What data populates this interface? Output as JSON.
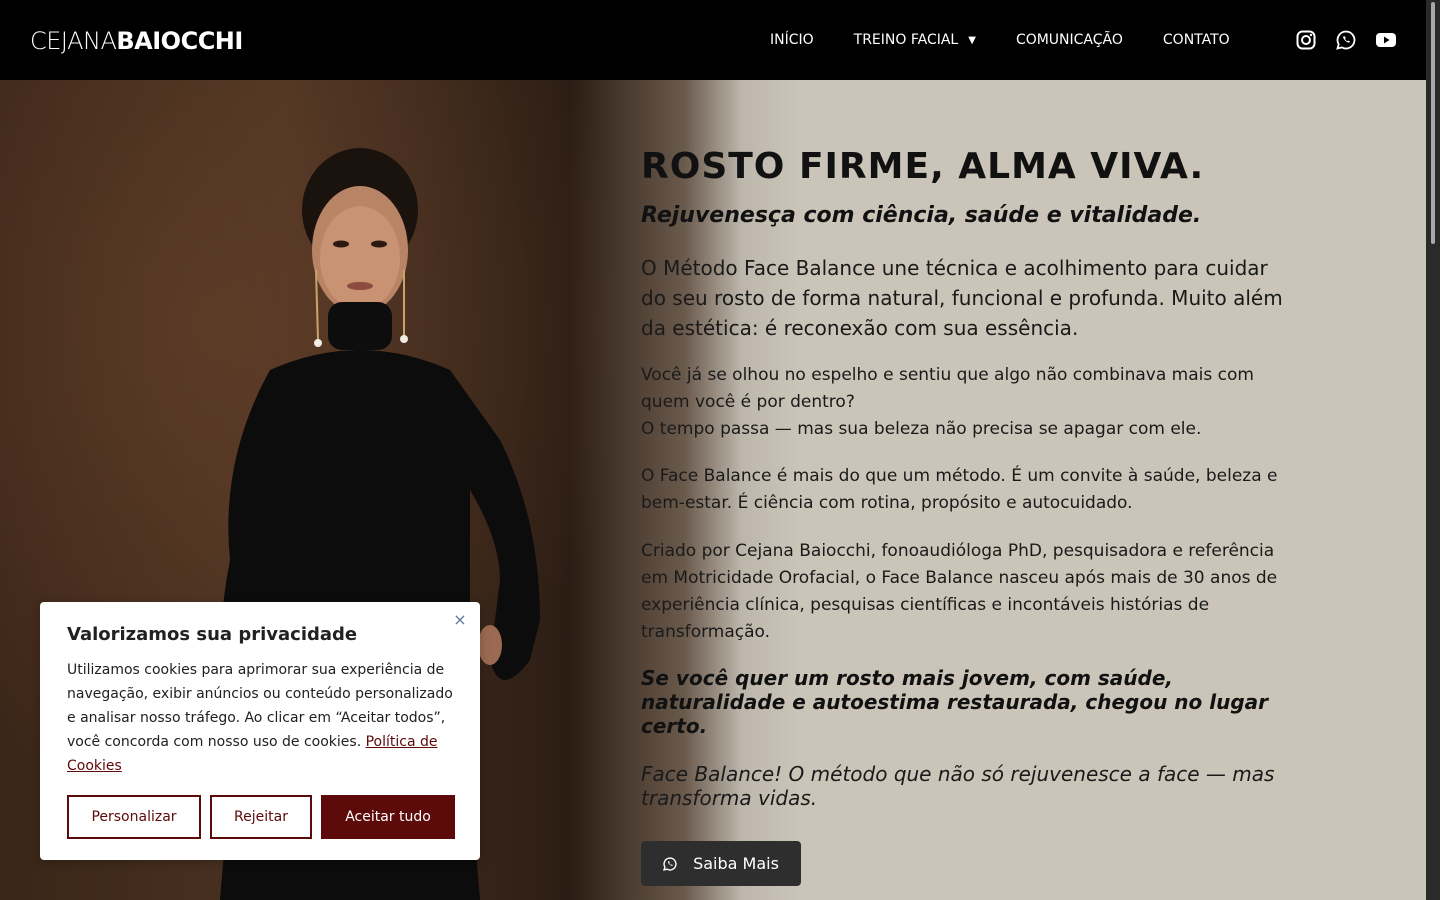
{
  "header": {
    "logo_light": "CEJANA",
    "logo_bold": "BAIOCCHI",
    "nav": [
      {
        "label": "INÍCIO"
      },
      {
        "label": "TREINO FACIAL"
      },
      {
        "label": "COMUNICAÇÃO"
      },
      {
        "label": "CONTATO"
      }
    ],
    "socials": [
      "instagram-icon",
      "whatsapp-icon",
      "youtube-icon"
    ]
  },
  "hero": {
    "title": "ROSTO FIRME, ALMA VIVA.",
    "subtitle": "Rejuvenesça com ciência, saúde e vitalidade.",
    "intro": "O Método Face Balance une técnica e acolhimento para cuidar do seu rosto de forma natural, funcional e profunda. Muito além da estética: é reconexão com sua essência.",
    "p1_line1": "Você já se olhou no espelho e sentiu que algo não combinava mais com quem você é por dentro?",
    "p1_line2": "O tempo passa — mas sua beleza não precisa se apagar com ele.",
    "p2": "O Face Balance é mais do que um método. É um convite à saúde, beleza e bem-estar. É ciência com rotina, propósito e autocuidado.",
    "p3": "Criado por Cejana Baiocchi, fonoaudióloga PhD, pesquisadora e referência em Motricidade Orofacial, o Face Balance nasceu após mais de 30 anos de experiência clínica, pesquisas científicas e incontáveis histórias de transformação.",
    "highlight": "Se você quer um rosto mais jovem, com saúde, naturalidade e autoestima restaurada, chegou no lugar certo.",
    "tagline": "Face Balance! O método que não só rejuvenesce a face — mas transforma vidas.",
    "cta_label": "Saiba Mais"
  },
  "cookie": {
    "title": "Valorizamos sua privacidade",
    "text": "Utilizamos cookies para aprimorar sua experiência de navegação, exibir anúncios ou conteúdo personalizado e analisar nosso tráfego. Ao clicar em “Aceitar todos”, você concorda com nosso uso de cookies.",
    "link": "Política de Cookies",
    "customize_label": "Personalizar",
    "reject_label": "Rejeitar",
    "accept_label": "Aceitar tudo"
  },
  "colors": {
    "header_bg": "#000000",
    "hero_bg": "#cbc4b8",
    "cta_bg": "#2e2e2e",
    "cookie_accent": "#5d0a0a"
  }
}
